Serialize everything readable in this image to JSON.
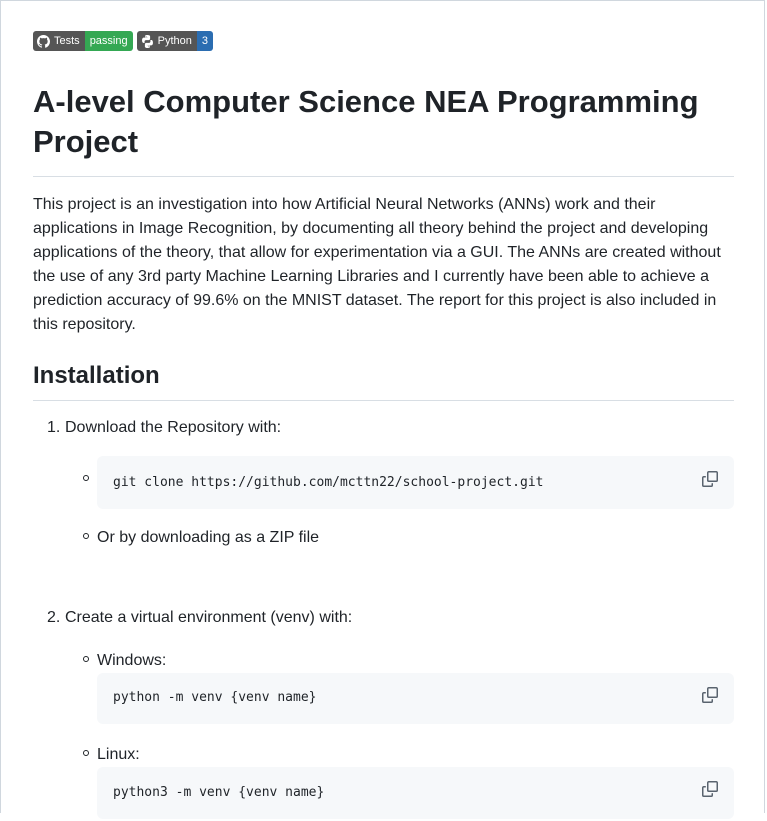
{
  "badges": [
    {
      "left": "Tests",
      "right": "passing",
      "right_color": "#34a853",
      "icon": "github-icon"
    },
    {
      "left": "Python",
      "right": "3",
      "right_color": "#2b6db1",
      "icon": "python-icon"
    }
  ],
  "title": "A-level Computer Science NEA Programming Project",
  "description": "This project is an investigation into how Artificial Neural Networks (ANNs) work and their applications in Image Recognition, by documenting all theory behind the project and developing applications of the theory, that allow for experimentation via a GUI. The ANNs are created without the use of any 3rd party Machine Learning Libraries and I currently have been able to achieve a prediction accuracy of 99.6% on the MNIST dataset. The report for this project is also included in this repository.",
  "installation": {
    "heading": "Installation",
    "steps": [
      {
        "num": "1.",
        "text": "Download the Repository with:",
        "code": "git clone https://github.com/mcttn22/school-project.git",
        "alt": "Or by downloading as a ZIP file"
      },
      {
        "num": "2.",
        "text": "Create a virtual environment (venv) with:",
        "windows_label": "Windows:",
        "windows_code": "python -m venv {venv name}",
        "linux_label": "Linux:",
        "linux_code": "python3 -m venv {venv name}"
      }
    ]
  }
}
